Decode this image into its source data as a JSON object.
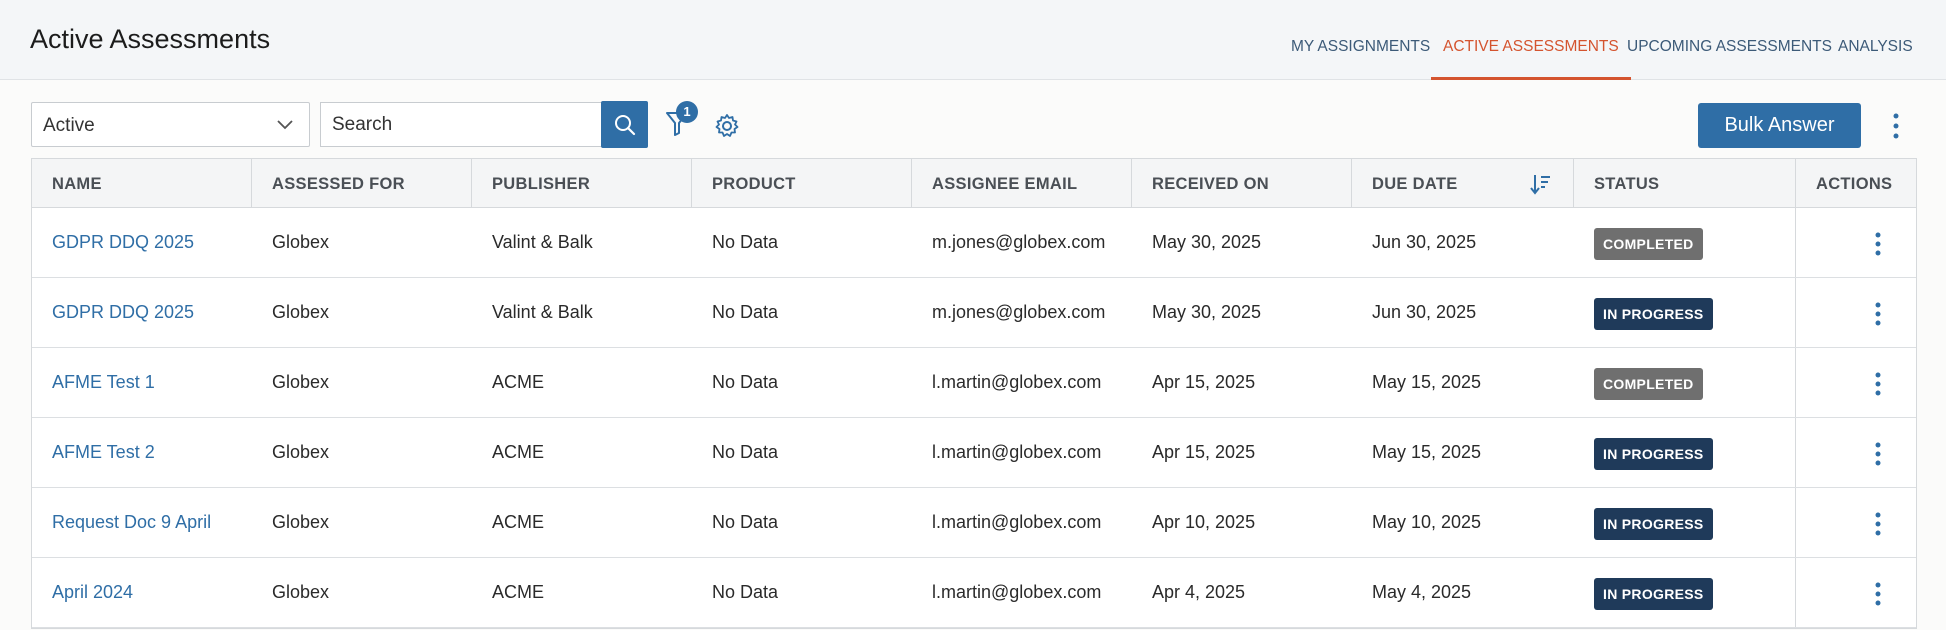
{
  "header": {
    "title": "Active Assessments",
    "tabs": [
      {
        "label": "MY ASSIGNMENTS",
        "active": false
      },
      {
        "label": "ACTIVE ASSESSMENTS",
        "active": true
      },
      {
        "label": "UPCOMING ASSESSMENTS",
        "active": false
      },
      {
        "label": "ANALYSIS",
        "active": false
      }
    ]
  },
  "toolbar": {
    "status_filter": "Active",
    "search_placeholder": "Search",
    "filter_count": "1",
    "bulk_answer_label": "Bulk Answer"
  },
  "table": {
    "columns": [
      "NAME",
      "ASSESSED FOR",
      "PUBLISHER",
      "PRODUCT",
      "ASSIGNEE EMAIL",
      "RECEIVED ON",
      "DUE DATE",
      "STATUS",
      "ACTIONS"
    ],
    "sorted_column": "DUE DATE",
    "rows": [
      {
        "name": "GDPR DDQ 2025",
        "assessed_for": "Globex",
        "publisher": "Valint & Balk",
        "product": "No Data",
        "email": "m.jones@globex.com",
        "received": "May 30, 2025",
        "due": "Jun 30, 2025",
        "status": "COMPLETED",
        "status_kind": "completed"
      },
      {
        "name": "GDPR DDQ 2025",
        "assessed_for": "Globex",
        "publisher": "Valint & Balk",
        "product": "No Data",
        "email": "m.jones@globex.com",
        "received": "May 30, 2025",
        "due": "Jun 30, 2025",
        "status": "IN PROGRESS",
        "status_kind": "inprogress"
      },
      {
        "name": "AFME Test 1",
        "assessed_for": "Globex",
        "publisher": "ACME",
        "product": "No Data",
        "email": "l.martin@globex.com",
        "received": "Apr 15, 2025",
        "due": "May 15, 2025",
        "status": "COMPLETED",
        "status_kind": "completed"
      },
      {
        "name": "AFME Test 2",
        "assessed_for": "Globex",
        "publisher": "ACME",
        "product": "No Data",
        "email": "l.martin@globex.com",
        "received": "Apr 15, 2025",
        "due": "May 15, 2025",
        "status": "IN PROGRESS",
        "status_kind": "inprogress"
      },
      {
        "name": "Request Doc 9 April",
        "assessed_for": "Globex",
        "publisher": "ACME",
        "product": "No Data",
        "email": "l.martin@globex.com",
        "received": "Apr 10, 2025",
        "due": "May 10, 2025",
        "status": "IN PROGRESS",
        "status_kind": "inprogress"
      },
      {
        "name": "April 2024",
        "assessed_for": "Globex",
        "publisher": "ACME",
        "product": "No Data",
        "email": "l.martin@globex.com",
        "received": "Apr 4, 2025",
        "due": "May 4, 2025",
        "status": "IN PROGRESS",
        "status_kind": "inprogress"
      }
    ]
  },
  "colors": {
    "accent": "#2f6ea6",
    "active_tab": "#d4542f",
    "completed_badge": "#6f6f6f",
    "in_progress_badge": "#1f3a5a"
  }
}
